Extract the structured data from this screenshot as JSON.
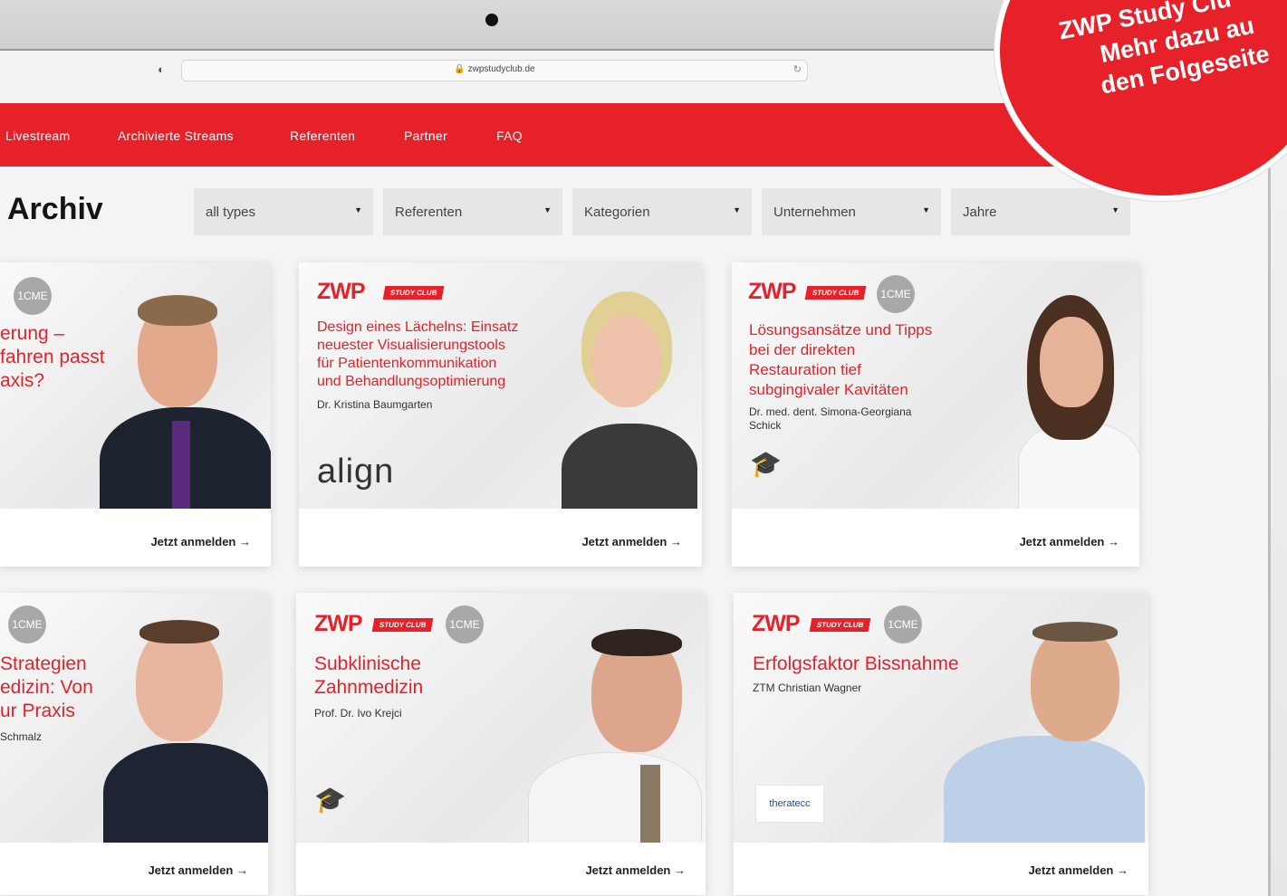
{
  "browser": {
    "url": "zwpstudyclub.de"
  },
  "nav": {
    "items": [
      "Livestream",
      "Archivierte Streams",
      "Referenten",
      "Partner",
      "FAQ"
    ]
  },
  "archive": {
    "title": "Archiv"
  },
  "filters": [
    {
      "label": "all types"
    },
    {
      "label": "Referenten"
    },
    {
      "label": "Kategorien"
    },
    {
      "label": "Unternehmen"
    },
    {
      "label": "Jahre"
    }
  ],
  "cards": [
    {
      "zwp": "",
      "study_club": "",
      "cme": "1CME",
      "title_lines": [
        "erung –",
        "fahren passt",
        "axis?"
      ],
      "speaker": "",
      "logo": "",
      "cta": "Jetzt anmelden"
    },
    {
      "zwp": "ZWP",
      "study_club": "STUDY CLUB",
      "cme": "",
      "title_lines": [
        "Design eines Lächelns: Einsatz",
        "neuester Visualisierungstools",
        "für Patientenkommunikation",
        "und Behandlungsoptimierung"
      ],
      "speaker": "Dr. Kristina Baumgarten",
      "logo": "align",
      "cta": "Jetzt anmelden"
    },
    {
      "zwp": "ZWP",
      "study_club": "STUDY CLUB",
      "cme": "1CME",
      "title_lines": [
        "Lösungsansätze und Tipps",
        "bei der direkten",
        "Restauration tief",
        "subgingivaler Kavitäten"
      ],
      "speaker": "Dr. med. dent. Simona-Georgiana Schick",
      "logo": "",
      "cta": "Jetzt anmelden"
    },
    {
      "zwp": "",
      "study_club": "",
      "cme": "1CME",
      "title_lines": [
        "Strategien",
        "edizin: Von",
        "ur Praxis"
      ],
      "speaker": "Schmalz",
      "logo": "",
      "cta": "Jetzt anmelden"
    },
    {
      "zwp": "ZWP",
      "study_club": "STUDY CLUB",
      "cme": "1CME",
      "title_lines": [
        "Subklinische",
        "Zahnmedizin"
      ],
      "speaker": "Prof. Dr. Ivo Krejci",
      "logo": "",
      "cta": "Jetzt anmelden"
    },
    {
      "zwp": "ZWP",
      "study_club": "STUDY CLUB",
      "cme": "1CME",
      "title_lines": [
        "Erfolgsfaktor Bissnahme"
      ],
      "speaker": "ZTM Christian Wagner",
      "logo": "theratecc",
      "cta": "Jetzt anmelden"
    }
  ],
  "promo": {
    "lines": [
      "ZWP Study Clu",
      "Mehr dazu au",
      "den Folgeseite"
    ]
  },
  "colors": {
    "brand_red": "#e62129",
    "nav_text": "#ffffff",
    "cme_badge": "#a8a8a8"
  }
}
